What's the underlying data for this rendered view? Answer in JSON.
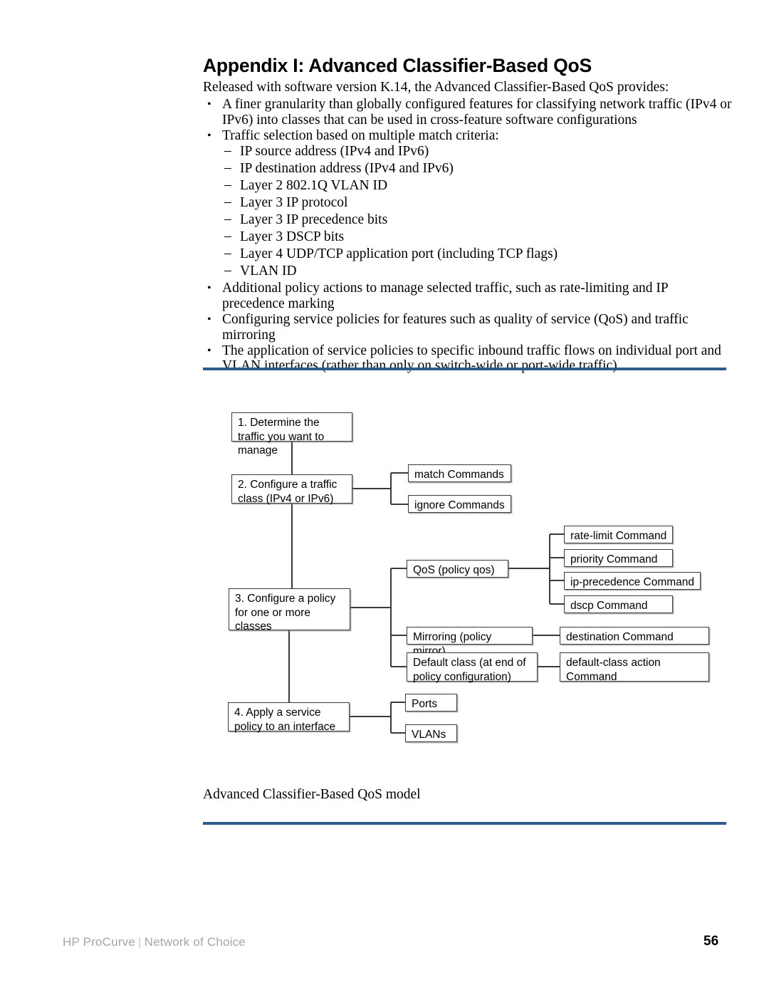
{
  "document": {
    "title": "Appendix I: Advanced Classifier-Based QoS",
    "intro": "Released with software version K.14, the Advanced Classifier-Based QoS provides:",
    "bullets": [
      {
        "marker": "•",
        "text": "A finer granularity than globally configured features for classifying network traffic (IPv4 or IPv6) into classes that can be used in cross-feature software configurations"
      },
      {
        "marker": "•",
        "text": "Traffic selection based on multiple match criteria:"
      }
    ],
    "sub_bullets": [
      {
        "marker": "–",
        "text": "IP source address (IPv4 and IPv6)"
      },
      {
        "marker": "–",
        "text": "IP destination address (IPv4 and IPv6)"
      },
      {
        "marker": "–",
        "text": "Layer 2 802.1Q VLAN ID"
      },
      {
        "marker": "–",
        "text": "Layer 3 IP protocol"
      },
      {
        "marker": "–",
        "text": "Layer 3 IP precedence bits"
      },
      {
        "marker": "–",
        "text": "Layer 3 DSCP bits"
      },
      {
        "marker": "–",
        "text": "Layer 4 UDP/TCP application port (including TCP flags)"
      },
      {
        "marker": "–",
        "text": "VLAN ID"
      }
    ],
    "bullets_after": [
      {
        "marker": "•",
        "text": "Additional policy actions to manage selected traffic, such as rate-limiting and IP precedence marking"
      },
      {
        "marker": "•",
        "text": "Configuring service policies for features such as quality of service (QoS) and traffic mirroring"
      },
      {
        "marker": "•",
        "text": "The application of service policies to specific inbound traffic flows on individual port and VLAN interfaces (rather than only on switch-wide or port-wide traffic)"
      }
    ],
    "figure_caption": "Advanced Classifier-Based QoS model",
    "rule_color": "#2e5d8d"
  },
  "diagram": {
    "nodes": {
      "step1": "1. Determine the traffic you want to manage",
      "step2": "2. Configure a traffic class (IPv4 or IPv6)",
      "step3": "3. Configure a policy for one or more classes",
      "step4": "4. Apply a service policy to an interface",
      "match": "match Commands",
      "ignore": "ignore Commands",
      "qos": "QoS (policy qos)",
      "rate_limit": "rate-limit Command",
      "priority": "priority Command",
      "ip_precedence": "ip-precedence Command",
      "dscp": "dscp Command",
      "mirroring": "Mirroring (policy mirror)",
      "destination": "destination Command",
      "default_class": "Default class (at end of policy configuration)",
      "default_class_action": "default-class action Command",
      "ports": "Ports",
      "vlans": "VLANs"
    }
  },
  "footer": {
    "brand": "HP ProCurve",
    "separator": "|",
    "tagline": "Network of Choice",
    "page_number": "56"
  }
}
